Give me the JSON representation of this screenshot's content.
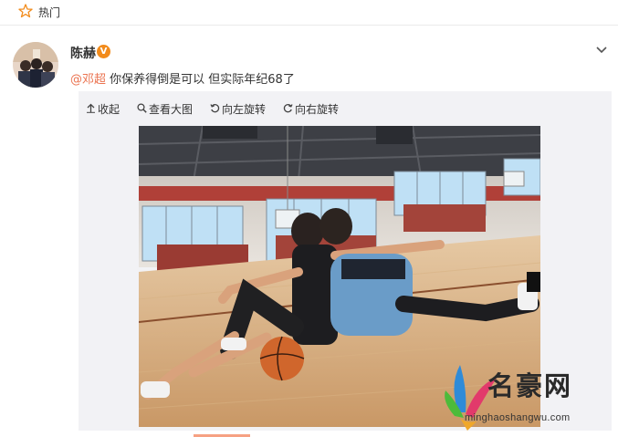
{
  "topbar": {
    "label": "热门",
    "icon": "star-icon"
  },
  "post": {
    "author": "陈赫",
    "verified_badge": "V",
    "mention": "@邓超",
    "text": " 你保养得倒是可以 但实际年纪68了"
  },
  "media_tools": {
    "collapse": "收起",
    "view_large": "查看大图",
    "rotate_left": "向左旋转",
    "rotate_right": "向右旋转"
  },
  "watermark": {
    "name": "名豪网",
    "url": "minghaoshangwu.com"
  },
  "colors": {
    "mention": "#eb7350",
    "badge": "#f28b1b",
    "media_bg": "#f2f2f5"
  }
}
